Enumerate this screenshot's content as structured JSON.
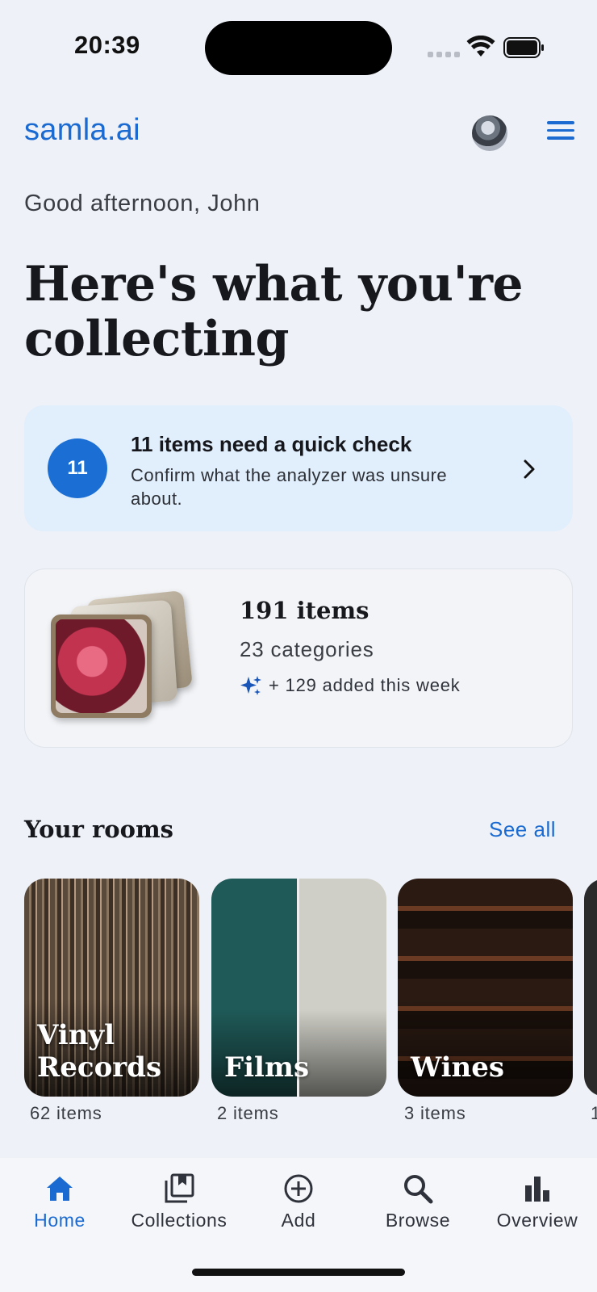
{
  "status_bar": {
    "time": "20:39"
  },
  "header": {
    "brand": "samla.ai"
  },
  "greeting": "Good afternoon, John",
  "headline": "Here's what you're collecting",
  "quick_check": {
    "count": "11",
    "title": "11 items need a quick check",
    "description": "Confirm what the analyzer was unsure about."
  },
  "stats": {
    "items": "191 items",
    "categories": "23 categories",
    "added": "+ 129 added this week"
  },
  "rooms": {
    "title": "Your rooms",
    "see_all": "See all",
    "items": [
      {
        "name": "Vinyl Records",
        "count": "62 items"
      },
      {
        "name": "Films",
        "count": "2 items"
      },
      {
        "name": "Wines",
        "count": "3 items"
      },
      {
        "name": "",
        "count": "1"
      }
    ]
  },
  "nav": {
    "items": [
      {
        "label": "Home",
        "icon": "home-icon",
        "active": true
      },
      {
        "label": "Collections",
        "icon": "collections-icon",
        "active": false
      },
      {
        "label": "Add",
        "icon": "add-icon",
        "active": false
      },
      {
        "label": "Browse",
        "icon": "search-icon",
        "active": false
      },
      {
        "label": "Overview",
        "icon": "bar-chart-icon",
        "active": false
      }
    ]
  },
  "colors": {
    "accent": "#1a6ad1",
    "badge": "#1b6fd4",
    "check_card_bg": "#e1eefb"
  }
}
